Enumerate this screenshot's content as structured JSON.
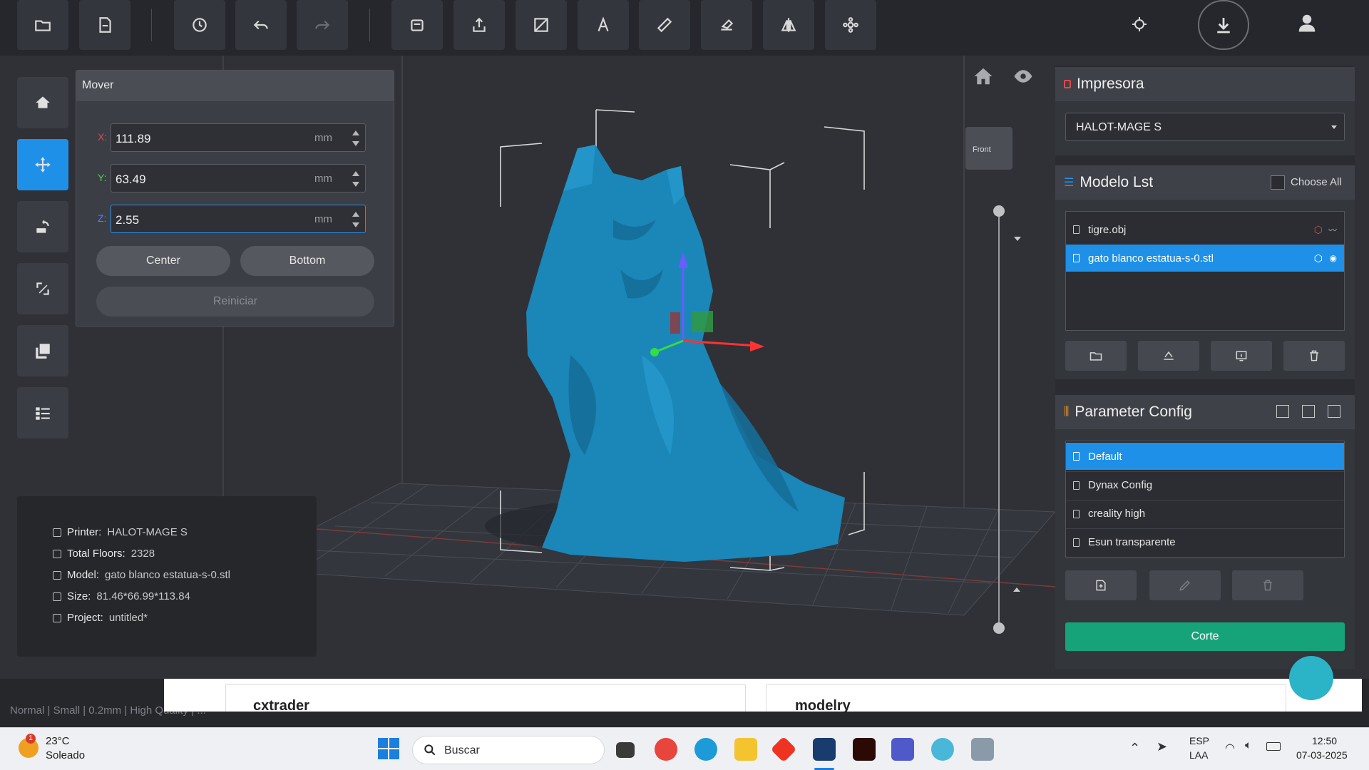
{
  "toolbar": {
    "buttons": [
      "open-folder-icon",
      "open-file-icon",
      "history-icon",
      "undo-icon",
      "redo-icon",
      "object-icon",
      "export-icon",
      "hollow-icon",
      "text-icon",
      "ruler-icon",
      "eraser-icon",
      "mirror-icon",
      "support-icon"
    ],
    "right_icons": [
      "target-icon",
      "download-icon",
      "user-icon"
    ]
  },
  "left_tools": [
    "home-icon",
    "move-icon",
    "rotate-icon",
    "scale-icon",
    "duplicate-icon",
    "list-icon"
  ],
  "mover": {
    "title": "Mover",
    "x_label": "X:",
    "x_value": "111.89",
    "y_label": "Y:",
    "y_value": "63.49",
    "z_label": "Z:",
    "z_value": "2.55",
    "unit": "mm",
    "center_label": "Center",
    "bottom_label": "Bottom",
    "reset_label": "Reiniciar"
  },
  "info": {
    "printer_key": "Printer:",
    "printer_val": "HALOT-MAGE S",
    "floors_key": "Total Floors:",
    "floors_val": "2328",
    "model_key": "Model:",
    "model_val": "gato blanco estatua-s-0.stl",
    "size_key": "Size:",
    "size_val": "81.46*66.99*113.84",
    "project_key": "Project:",
    "project_val": "untitled*"
  },
  "view_cube": {
    "front_label": "Front"
  },
  "printer_panel": {
    "title": "Impresora",
    "selected": "HALOT-MAGE S"
  },
  "model_list": {
    "title": "Modelo Lst",
    "choose_all": "Choose All",
    "items": [
      "tigre.obj",
      "gato blanco estatua-s-0.stl"
    ],
    "selected_index": 1
  },
  "param_config": {
    "title": "Parameter Config",
    "items": [
      "Default",
      "Dynax Config",
      "creality high",
      "Esun transparente"
    ],
    "selected_index": 0
  },
  "slice_button": "Corte",
  "status_bar": {
    "text": "Normal | Small | 0.2mm | High Quality | ..."
  },
  "ad": {
    "left_brand": "cxtrader",
    "right_brand": "modelry"
  },
  "taskbar": {
    "weather_temp": "23°C",
    "weather_desc": "Soleado",
    "weather_badge": "1",
    "search_placeholder": "Buscar",
    "lang_top": "ESP",
    "lang_bottom": "LAA",
    "time": "12:50",
    "date": "07-03-2025"
  },
  "colors": {
    "accent": "#1e90e8",
    "slice": "#16a37a",
    "model": "#1b86b8"
  }
}
